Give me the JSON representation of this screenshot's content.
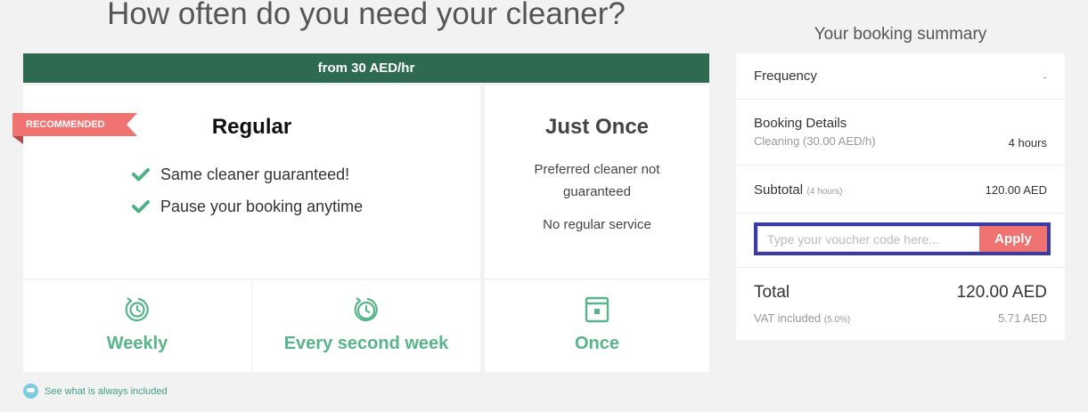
{
  "page": {
    "title": "How often do you need your cleaner?"
  },
  "price_bar": {
    "text": "from 30 AED/hr"
  },
  "plans": {
    "regular": {
      "badge": "RECOMMENDED",
      "title": "Regular",
      "features": [
        "Same cleaner guaranteed!",
        "Pause your booking anytime"
      ]
    },
    "once": {
      "title": "Just Once",
      "line1": "Preferred cleaner not guaranteed",
      "line2": "No regular service"
    }
  },
  "frequencies": [
    {
      "label": "Weekly",
      "icon": "clock-refresh-icon"
    },
    {
      "label": "Every second week",
      "icon": "clock-refresh-icon"
    },
    {
      "label": "Once",
      "icon": "calendar-icon"
    }
  ],
  "included_link": {
    "text": "See what is always included",
    "icon": "chat-bubble-icon"
  },
  "summary": {
    "title": "Your booking summary",
    "frequency_label": "Frequency",
    "frequency_value": "-",
    "details_label": "Booking Details",
    "details_sub": "Cleaning (30.00 AED/h)",
    "details_value": "4 hours",
    "subtotal_label": "Subtotal",
    "subtotal_hours": "(4 hours)",
    "subtotal_value": "120.00 AED",
    "voucher_placeholder": "Type your voucher code here...",
    "voucher_button": "Apply",
    "total_label": "Total",
    "total_value": "120.00 AED",
    "vat_label": "VAT included",
    "vat_rate": "(5.0%)",
    "vat_value": "5.71 AED"
  },
  "colors": {
    "brand_green": "#2d6a4f",
    "accent_green": "#58b58a",
    "coral": "#f07372",
    "focus_border": "#3b3ba6"
  }
}
